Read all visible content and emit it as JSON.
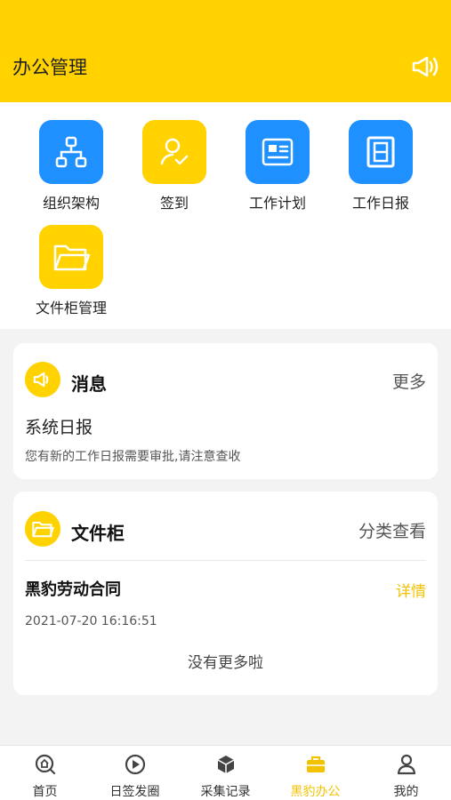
{
  "header": {
    "title": "办公管理"
  },
  "grid": {
    "items": [
      {
        "label": "组织架构"
      },
      {
        "label": "签到"
      },
      {
        "label": "工作计划"
      },
      {
        "label": "工作日报"
      },
      {
        "label": "文件柜管理"
      }
    ]
  },
  "message": {
    "title": "消息",
    "more": "更多",
    "item_title": "系统日报",
    "item_desc": "您有新的工作日报需要审批,请注意查收"
  },
  "cabinet": {
    "title": "文件柜",
    "more": "分类查看",
    "item_title": "黑豹劳动合同",
    "item_action": "详情",
    "item_time": "2021-07-20 16:16:51",
    "no_more": "没有更多啦"
  },
  "tabbar": {
    "items": [
      {
        "label": "首页"
      },
      {
        "label": "日签发圈"
      },
      {
        "label": "采集记录"
      },
      {
        "label": "黑豹办公"
      },
      {
        "label": "我的"
      }
    ],
    "active_index": 3
  },
  "colors": {
    "accent": "#FFD200",
    "blue": "#1E90FF",
    "active_tab": "#F2C200"
  }
}
